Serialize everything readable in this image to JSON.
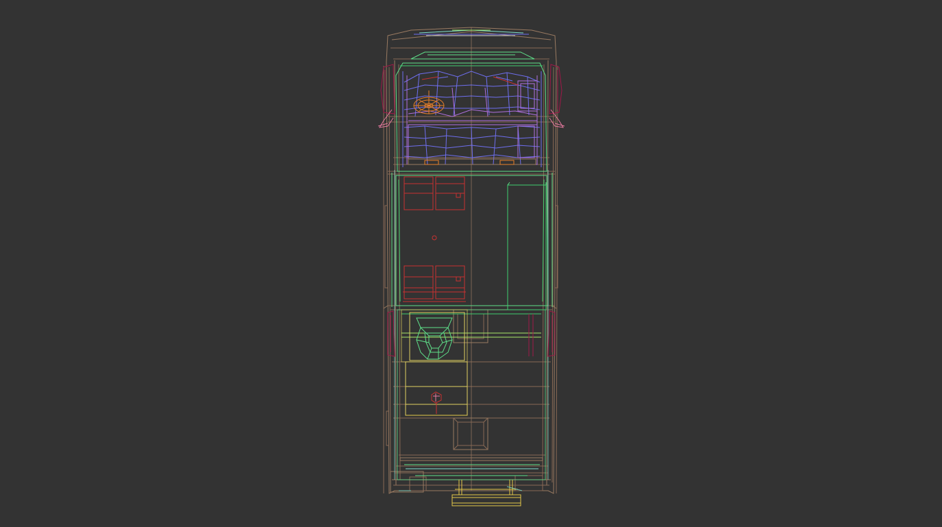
{
  "viewport": {
    "view": "top-orthographic",
    "display_mode": "wireframe",
    "subject": "vehicle-top-view-wireframe"
  },
  "colors": {
    "background": "#333333",
    "body_outline": "#9a7b62",
    "interior_frame": "#5fe08a",
    "mesh_bed": "#6f6ff0",
    "seats": "#c83232",
    "wheels": "#a01848",
    "bumper": "#e6c84a",
    "steering": "#e8802a"
  }
}
